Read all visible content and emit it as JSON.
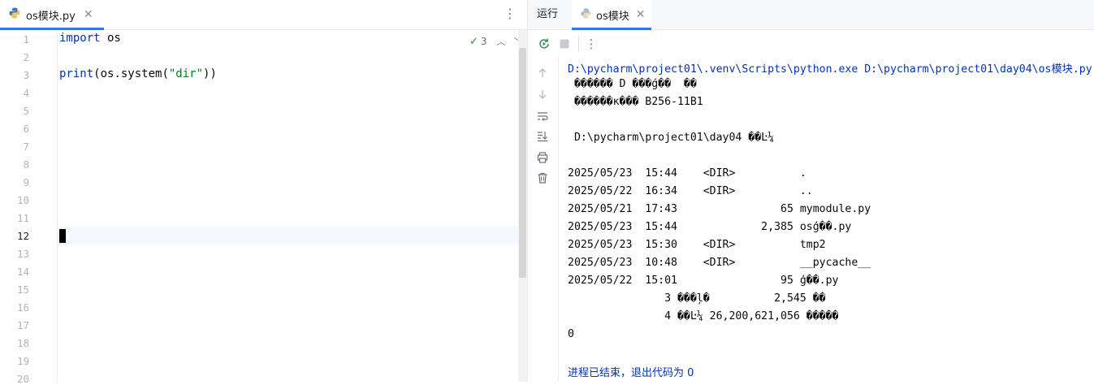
{
  "editor": {
    "tab_label": "os模块.py",
    "inspection_count": "3",
    "line_numbers": [
      "1",
      "2",
      "3",
      "4",
      "5",
      "6",
      "7",
      "8",
      "9",
      "10",
      "11",
      "12",
      "13",
      "14",
      "15",
      "16",
      "17",
      "18",
      "19",
      "20"
    ],
    "code": {
      "l1_kw": "import",
      "l1_rest": " os",
      "l3_fn": "print",
      "l3_a": "(os.system(",
      "l3_str": "\"dir\"",
      "l3_b": "))"
    }
  },
  "run": {
    "title": "运行",
    "tab_label": "os模块",
    "output": [
      "D:\\pycharm\\project01\\.venv\\Scripts\\python.exe D:\\pycharm\\project01\\day04\\os模块.py",
      " ������ D ���ǵ��  ��",
      " ������к��� B256-11B1",
      "",
      " D:\\pycharm\\project01\\day04 ��Ŀ¼",
      "",
      "2025/05/23  15:44    <DIR>          .",
      "2025/05/22  16:34    <DIR>          ..",
      "2025/05/21  17:43                65 mymodule.py",
      "2025/05/23  15:44             2,385 osģ��.py",
      "2025/05/23  15:30    <DIR>          tmp2",
      "2025/05/23  10:48    <DIR>          __pycache__",
      "2025/05/22  15:01                95 ģ��.py",
      "               3 ���ļ�          2,545 ��",
      "               4 ��Ŀ¼ 26,200,621,056 �����",
      "0",
      "",
      "进程已结束，退出代码为 0"
    ]
  },
  "colors": {
    "accent": "#3574f0",
    "keyword": "#0033b3",
    "string": "#067d17"
  },
  "icons": [
    "python-file-icon",
    "close-icon",
    "more-vert-icon",
    "check-icon",
    "chevron-up-icon",
    "chevron-down-icon",
    "rerun-icon",
    "stop-icon",
    "arrow-up-icon",
    "arrow-down-icon",
    "soft-wrap-icon",
    "scroll-to-end-icon",
    "print-icon",
    "trash-icon"
  ]
}
